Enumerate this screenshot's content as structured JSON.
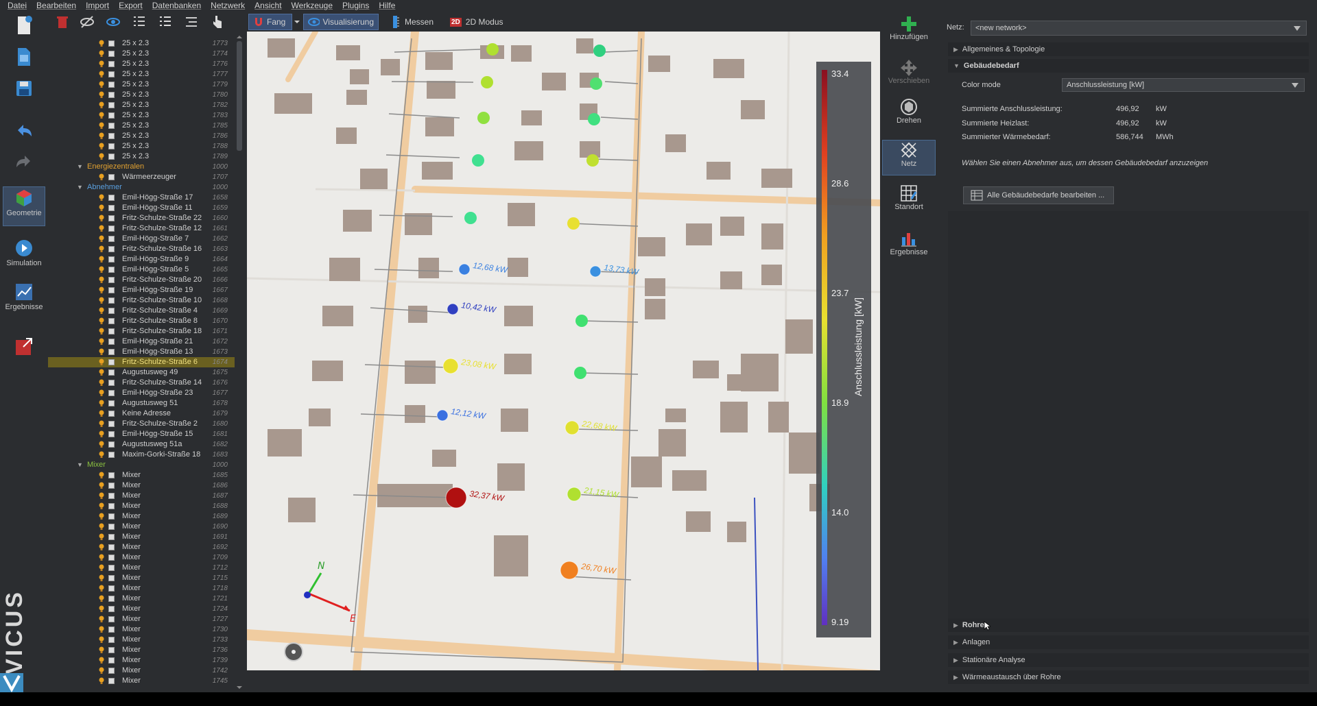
{
  "menu": [
    "Datei",
    "Bearbeiten",
    "Import",
    "Export",
    "Datenbanken",
    "Netzwerk",
    "Ansicht",
    "Werkzeuge",
    "Plugins",
    "Hilfe"
  ],
  "leftbar": {
    "geometrie": "Geometrie",
    "simulation": "Simulation",
    "ergebnisse": "Ergebnisse",
    "brand": "VICUS"
  },
  "toolbar": {
    "fang": "Fang",
    "visualisierung": "Visualisierung",
    "messen": "Messen",
    "modus2d": "2D Modus",
    "badge2d": "2D"
  },
  "tree": [
    {
      "t": "item",
      "l": "25 x 2.3",
      "id": "1773"
    },
    {
      "t": "item",
      "l": "25 x 2.3",
      "id": "1774"
    },
    {
      "t": "item",
      "l": "25 x 2.3",
      "id": "1776"
    },
    {
      "t": "item",
      "l": "25 x 2.3",
      "id": "1777"
    },
    {
      "t": "item",
      "l": "25 x 2.3",
      "id": "1779"
    },
    {
      "t": "item",
      "l": "25 x 2.3",
      "id": "1780"
    },
    {
      "t": "item",
      "l": "25 x 2.3",
      "id": "1782"
    },
    {
      "t": "item",
      "l": "25 x 2.3",
      "id": "1783"
    },
    {
      "t": "item",
      "l": "25 x 2.3",
      "id": "1785"
    },
    {
      "t": "item",
      "l": "25 x 2.3",
      "id": "1786"
    },
    {
      "t": "item",
      "l": "25 x 2.3",
      "id": "1788"
    },
    {
      "t": "item",
      "l": "25 x 2.3",
      "id": "1789"
    },
    {
      "t": "cat",
      "l": "Energiezentralen",
      "id": "1000",
      "c": "#e0a030"
    },
    {
      "t": "item",
      "l": "Wärmeerzeuger",
      "id": "1707"
    },
    {
      "t": "cat",
      "l": "Abnehmer",
      "id": "1000",
      "c": "#5aa0e0"
    },
    {
      "t": "item",
      "l": "Emil-Högg-Straße 17",
      "id": "1658"
    },
    {
      "t": "item",
      "l": "Emil-Högg-Straße 11",
      "id": "1659"
    },
    {
      "t": "item",
      "l": "Fritz-Schulze-Straße 22",
      "id": "1660"
    },
    {
      "t": "item",
      "l": "Fritz-Schulze-Straße 12",
      "id": "1661"
    },
    {
      "t": "item",
      "l": "Emil-Högg-Straße 7",
      "id": "1662"
    },
    {
      "t": "item",
      "l": "Fritz-Schulze-Straße 16",
      "id": "1663"
    },
    {
      "t": "item",
      "l": "Emil-Högg-Straße 9",
      "id": "1664"
    },
    {
      "t": "item",
      "l": "Emil-Högg-Straße 5",
      "id": "1665"
    },
    {
      "t": "item",
      "l": "Fritz-Schulze-Straße 20",
      "id": "1666"
    },
    {
      "t": "item",
      "l": "Emil-Högg-Straße 19",
      "id": "1667"
    },
    {
      "t": "item",
      "l": "Fritz-Schulze-Straße 10",
      "id": "1668"
    },
    {
      "t": "item",
      "l": "Fritz-Schulze-Straße 4",
      "id": "1669"
    },
    {
      "t": "item",
      "l": "Fritz-Schulze-Straße 8",
      "id": "1670"
    },
    {
      "t": "item",
      "l": "Fritz-Schulze-Straße 18",
      "id": "1671"
    },
    {
      "t": "item",
      "l": "Emil-Högg-Straße 21",
      "id": "1672"
    },
    {
      "t": "item",
      "l": "Emil-Högg-Straße 13",
      "id": "1673"
    },
    {
      "t": "item",
      "l": "Fritz-Schulze-Straße 6",
      "id": "1674",
      "sel": true
    },
    {
      "t": "item",
      "l": "Augustusweg 49",
      "id": "1675"
    },
    {
      "t": "item",
      "l": "Fritz-Schulze-Straße 14",
      "id": "1676"
    },
    {
      "t": "item",
      "l": "Emil-Högg-Straße 23",
      "id": "1677"
    },
    {
      "t": "item",
      "l": "Augustusweg 51",
      "id": "1678"
    },
    {
      "t": "item",
      "l": "Keine Adresse",
      "id": "1679"
    },
    {
      "t": "item",
      "l": "Fritz-Schulze-Straße 2",
      "id": "1680"
    },
    {
      "t": "item",
      "l": "Emil-Högg-Straße 15",
      "id": "1681"
    },
    {
      "t": "item",
      "l": "Augustusweg 51a",
      "id": "1682"
    },
    {
      "t": "item",
      "l": "Maxim-Gorki-Straße 18",
      "id": "1683"
    },
    {
      "t": "cat",
      "l": "Mixer",
      "id": "1000",
      "c": "#8ac040"
    },
    {
      "t": "item",
      "l": "Mixer",
      "id": "1685"
    },
    {
      "t": "item",
      "l": "Mixer",
      "id": "1686"
    },
    {
      "t": "item",
      "l": "Mixer",
      "id": "1687"
    },
    {
      "t": "item",
      "l": "Mixer",
      "id": "1688"
    },
    {
      "t": "item",
      "l": "Mixer",
      "id": "1689"
    },
    {
      "t": "item",
      "l": "Mixer",
      "id": "1690"
    },
    {
      "t": "item",
      "l": "Mixer",
      "id": "1691"
    },
    {
      "t": "item",
      "l": "Mixer",
      "id": "1692"
    },
    {
      "t": "item",
      "l": "Mixer",
      "id": "1709"
    },
    {
      "t": "item",
      "l": "Mixer",
      "id": "1712"
    },
    {
      "t": "item",
      "l": "Mixer",
      "id": "1715"
    },
    {
      "t": "item",
      "l": "Mixer",
      "id": "1718"
    },
    {
      "t": "item",
      "l": "Mixer",
      "id": "1721"
    },
    {
      "t": "item",
      "l": "Mixer",
      "id": "1724"
    },
    {
      "t": "item",
      "l": "Mixer",
      "id": "1727"
    },
    {
      "t": "item",
      "l": "Mixer",
      "id": "1730"
    },
    {
      "t": "item",
      "l": "Mixer",
      "id": "1733"
    },
    {
      "t": "item",
      "l": "Mixer",
      "id": "1736"
    },
    {
      "t": "item",
      "l": "Mixer",
      "id": "1739"
    },
    {
      "t": "item",
      "l": "Mixer",
      "id": "1742"
    },
    {
      "t": "item",
      "l": "Mixer",
      "id": "1745"
    }
  ],
  "viewport": {
    "legend_title": "Anschlussleistung [kW]",
    "legend_ticks": [
      "33.4",
      "28.6",
      "23.7",
      "18.9",
      "14.0",
      "9.19"
    ],
    "axis_n": "N",
    "axis_e": "E",
    "nodes": [
      {
        "label": "32,37 kW",
        "color": "#b01010"
      },
      {
        "label": "26,70 kW",
        "color": "#f08020"
      },
      {
        "label": "12,68 kW",
        "color": "#3a80e0"
      },
      {
        "label": "13,73 kW",
        "color": "#3a90e0"
      },
      {
        "label": "10,42 kW",
        "color": "#3040c0"
      },
      {
        "label": "12,12 kW",
        "color": "#3a70e0"
      },
      {
        "label": "23,08 kW",
        "color": "#e8e030"
      },
      {
        "label": "22,68 kW",
        "color": "#e0e030"
      },
      {
        "label": "21,15 kW",
        "color": "#b0e030"
      }
    ]
  },
  "rightbar": {
    "hinzufuegen": "Hinzufügen",
    "verschieben": "Verschieben",
    "drehen": "Drehen",
    "netz": "Netz",
    "standort": "Standort",
    "ergebnisse": "Ergebnisse"
  },
  "panel": {
    "netz_label": "Netz:",
    "netz_value": "<new network>",
    "sec_allgemein": "Allgemeines & Topologie",
    "sec_gebaeude": "Gebäudebedarf",
    "color_mode_label": "Color mode",
    "color_mode_value": "Anschlussleistung [kW]",
    "anschluss_label": "Summierte Anschlussleistung:",
    "anschluss_value": "496,92",
    "anschluss_unit": "kW",
    "heizlast_label": "Summierte Heizlast:",
    "heizlast_value": "496,92",
    "heizlast_unit": "kW",
    "waerme_label": "Summierter Wärmebedarf:",
    "waerme_value": "586,744",
    "waerme_unit": "MWh",
    "hint": "Wählen Sie einen Abnehmer aus, um dessen Gebäudebedarf anzuzeigen",
    "edit_button": "Alle Gebäudebedarfe bearbeiten ...",
    "sec_rohre": "Rohre",
    "sec_anlagen": "Anlagen",
    "sec_stationaer": "Stationäre Analyse",
    "sec_waermeaustausch": "Wärmeaustausch über Rohre"
  },
  "colors": {
    "accent": "#3a5074",
    "selection": "#6a6020",
    "road": "#f0c890",
    "building": "#a89a90",
    "pipe": "#777777"
  }
}
